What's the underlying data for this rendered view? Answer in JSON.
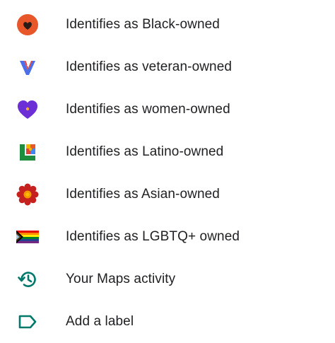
{
  "menu": {
    "items": [
      {
        "label": "Identifies as Black-owned",
        "icon": "black-owned-icon"
      },
      {
        "label": "Identifies as veteran-owned",
        "icon": "veteran-owned-icon"
      },
      {
        "label": "Identifies as women-owned",
        "icon": "women-owned-icon"
      },
      {
        "label": "Identifies as Latino-owned",
        "icon": "latino-owned-icon"
      },
      {
        "label": "Identifies as Asian-owned",
        "icon": "asian-owned-icon"
      },
      {
        "label": "Identifies as LGBTQ+ owned",
        "icon": "lgbtq-owned-icon"
      },
      {
        "label": "Your Maps activity",
        "icon": "history-icon"
      },
      {
        "label": "Add a label",
        "icon": "label-icon"
      }
    ]
  },
  "colors": {
    "text": "#202124",
    "accent_teal": "#00796b"
  }
}
